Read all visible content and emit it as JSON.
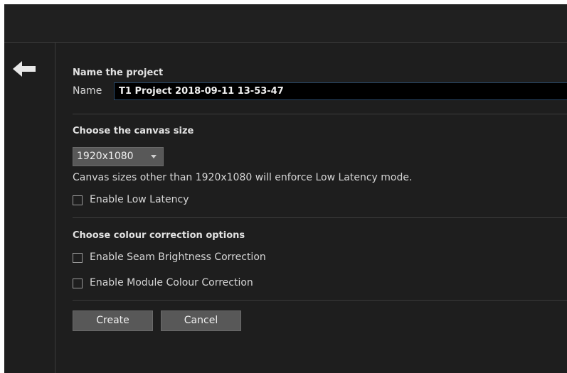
{
  "header": {
    "back_icon": "left-arrow-icon"
  },
  "project": {
    "section_title": "Name the project",
    "name_label": "Name",
    "name_value": "T1 Project 2018-09-11 13-53-47"
  },
  "canvas": {
    "section_title": "Choose the canvas size",
    "selected_size": "1920x1080",
    "dropdown_icon": "chevron-down-icon",
    "note": "Canvas sizes other than 1920x1080 will enforce Low Latency mode.",
    "low_latency_label": "Enable Low Latency",
    "low_latency_checked": false
  },
  "colour": {
    "section_title": "Choose colour correction options",
    "seam_label": "Enable Seam Brightness Correction",
    "seam_checked": false,
    "module_label": "Enable Module Colour Correction",
    "module_checked": false
  },
  "actions": {
    "create_label": "Create",
    "cancel_label": "Cancel"
  },
  "colors": {
    "background": "#1e1e1e",
    "button": "#585858",
    "input_bg": "#000000",
    "text": "#d6d6d6"
  }
}
